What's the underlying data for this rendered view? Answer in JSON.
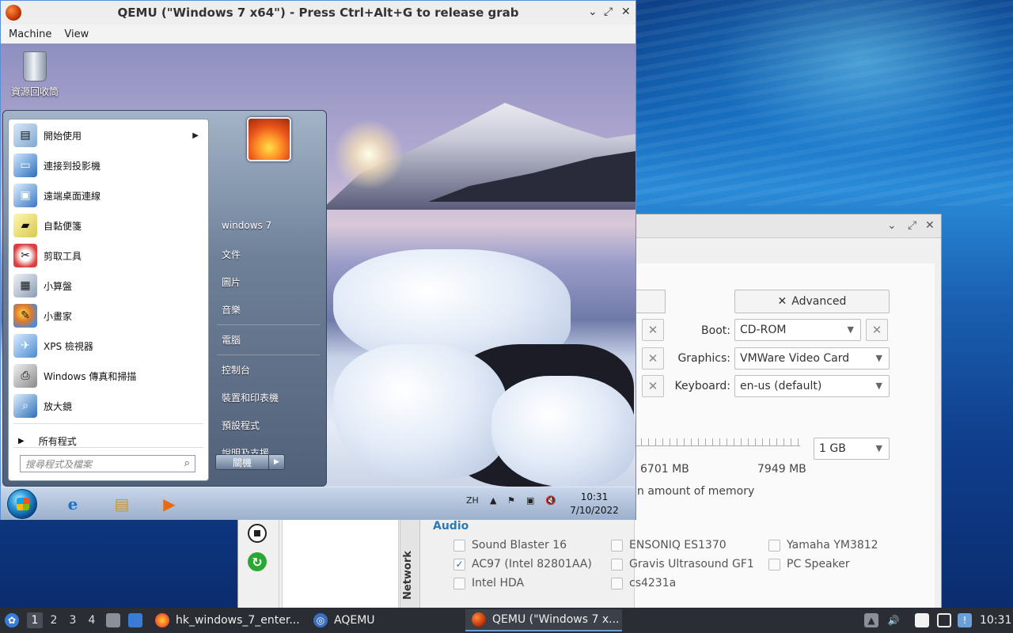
{
  "qemu_window": {
    "title": "QEMU (\"Windows 7 x64\") - Press Ctrl+Alt+G to release grab",
    "menu": [
      "Machine",
      "View"
    ],
    "controls": {
      "minimize": "⌄",
      "maximize": "⤢",
      "close": "✕"
    }
  },
  "guest": {
    "desktop_icons": [
      {
        "label": "資源回收筒",
        "icon": "recycle-bin-icon"
      }
    ],
    "start_menu": {
      "programs": [
        {
          "label": "開始使用",
          "icon": "getting-started-icon",
          "has_submenu": true
        },
        {
          "label": "連接到投影機",
          "icon": "projector-icon",
          "has_submenu": false
        },
        {
          "label": "遠端桌面連線",
          "icon": "remote-desktop-icon",
          "has_submenu": false
        },
        {
          "label": "自黏便箋",
          "icon": "sticky-notes-icon",
          "has_submenu": false
        },
        {
          "label": "剪取工具",
          "icon": "snipping-tool-icon",
          "has_submenu": false
        },
        {
          "label": "小算盤",
          "icon": "calculator-icon",
          "has_submenu": false
        },
        {
          "label": "小畫家",
          "icon": "paint-icon",
          "has_submenu": false
        },
        {
          "label": "XPS 檢視器",
          "icon": "xps-viewer-icon",
          "has_submenu": false
        },
        {
          "label": "Windows 傳真和掃描",
          "icon": "fax-scan-icon",
          "has_submenu": false
        },
        {
          "label": "放大鏡",
          "icon": "magnifier-icon",
          "has_submenu": false
        }
      ],
      "all_programs": "所有程式",
      "search_placeholder": "搜尋程式及檔案",
      "user_name": "windows 7",
      "right_items": [
        "文件",
        "圖片",
        "音樂",
        "電腦",
        "控制台",
        "裝置和印表機",
        "預設程式",
        "說明及支援"
      ],
      "shutdown_label": "關機"
    },
    "taskbar": {
      "pinned": [
        {
          "name": "internet-explorer-icon",
          "glyph": "e"
        },
        {
          "name": "file-explorer-icon",
          "glyph": "▤"
        },
        {
          "name": "media-player-icon",
          "glyph": "▶"
        }
      ],
      "lang": "ZH",
      "time": "10:31",
      "date": "7/10/2022"
    }
  },
  "aqemu_window": {
    "advanced_label": "Advanced",
    "boot_label": "Boot:",
    "boot_value": "CD-ROM",
    "graphics_label": "Graphics:",
    "graphics_value": "VMWare Video Card",
    "keyboard_label": "Keyboard:",
    "keyboard_value": "en-us (default)",
    "memory_value": "1 GB",
    "memory_free": "6701 MB",
    "memory_total": "7949 MB",
    "memory_note": "n amount of memory",
    "network_tab": "Network",
    "audio_title": "Audio",
    "audio_cards": [
      {
        "label": "Sound Blaster 16",
        "checked": false
      },
      {
        "label": "ENSONIQ ES1370",
        "checked": false
      },
      {
        "label": "Yamaha YM3812",
        "checked": false
      },
      {
        "label": "AC97 (Intel 82801AA)",
        "checked": true
      },
      {
        "label": "Gravis Ultrasound GF1",
        "checked": false
      },
      {
        "label": "PC Speaker",
        "checked": false
      },
      {
        "label": "Intel HDA",
        "checked": false
      },
      {
        "label": "cs4231a",
        "checked": false
      }
    ]
  },
  "host_taskbar": {
    "workspaces": [
      "1",
      "2",
      "3",
      "4"
    ],
    "active_workspace": "1",
    "tasks": [
      {
        "label": "hk_windows_7_enter...",
        "icon": "firefox-icon"
      },
      {
        "label": "AQEMU",
        "icon": "aqemu-icon"
      },
      {
        "label": "QEMU (\"Windows 7 x...",
        "icon": "qemu-icon"
      }
    ],
    "clock": "10:31"
  },
  "colors": {
    "audio_title": "#2a7ab8",
    "host_taskbar": "#2a2d34",
    "qemu_border": "#5a8fd8"
  }
}
